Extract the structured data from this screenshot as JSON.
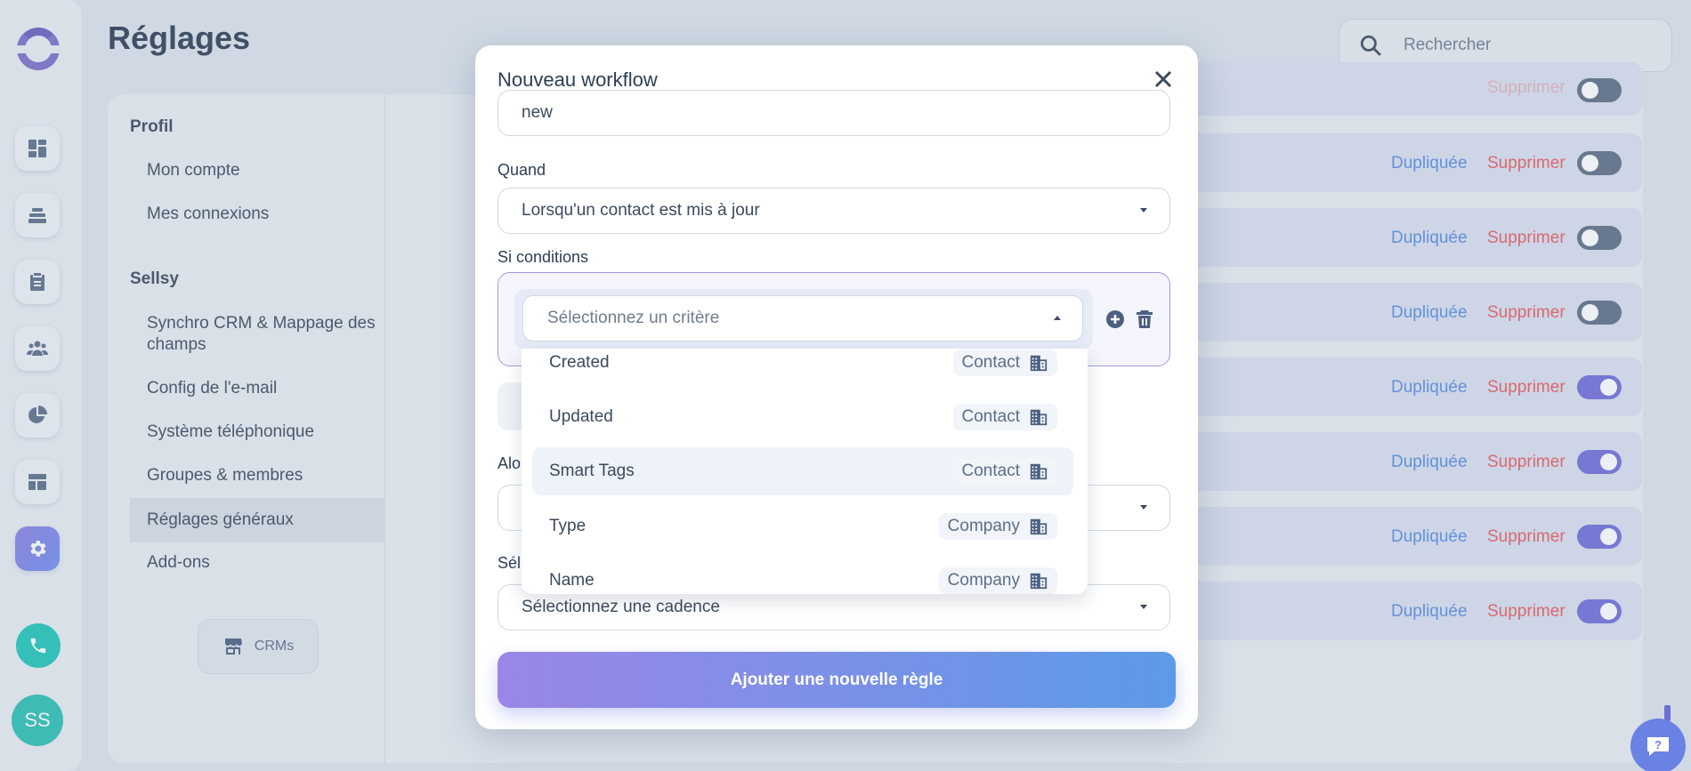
{
  "page": {
    "title": "Réglages"
  },
  "search": {
    "placeholder": "Rechercher"
  },
  "nav": {
    "sections": [
      {
        "title": "Profil",
        "items": [
          "Mon compte",
          "Mes connexions"
        ]
      },
      {
        "title": "Sellsy",
        "items": [
          "Synchro CRM & Mappage des champs",
          "Config de l'e-mail",
          "Système téléphonique",
          "Groupes & membres",
          "Réglages généraux",
          "Add-ons"
        ]
      }
    ],
    "active_item": "Réglages généraux",
    "crms_label": "CRMs"
  },
  "rail": {
    "icons": [
      "dashboard-icon",
      "layers-icon",
      "clipboard-icon",
      "team-icon",
      "pie-chart-icon",
      "layout-icon",
      "gear-icon"
    ],
    "active": "gear-icon",
    "avatar_initials": "SS"
  },
  "workflows": {
    "duplicate_label": "Dupliquée",
    "delete_label": "Supprimer",
    "rows": [
      {
        "enabled": false
      },
      {
        "enabled": false
      },
      {
        "enabled": false
      },
      {
        "enabled": true
      },
      {
        "enabled": true
      },
      {
        "enabled": true
      },
      {
        "enabled": true
      }
    ]
  },
  "modal": {
    "title": "Nouveau workflow",
    "name_value": "new",
    "when_label": "Quand",
    "when_value": "Lorsqu'un contact est mis à jour",
    "conditions_label": "Si conditions",
    "criteria_placeholder": "Sélectionnez un critère",
    "then_label_partial": "Alo",
    "select_label_partial": "Sél",
    "cadence_value": "Sélectionnez une cadence",
    "submit_label": "Ajouter une nouvelle règle",
    "criteria_options": [
      {
        "label": "Created",
        "tag": "Contact"
      },
      {
        "label": "Updated",
        "tag": "Contact"
      },
      {
        "label": "Smart Tags",
        "tag": "Contact"
      },
      {
        "label": "Type",
        "tag": "Company"
      },
      {
        "label": "Name",
        "tag": "Company"
      }
    ],
    "hovered_option": "Smart Tags"
  }
}
